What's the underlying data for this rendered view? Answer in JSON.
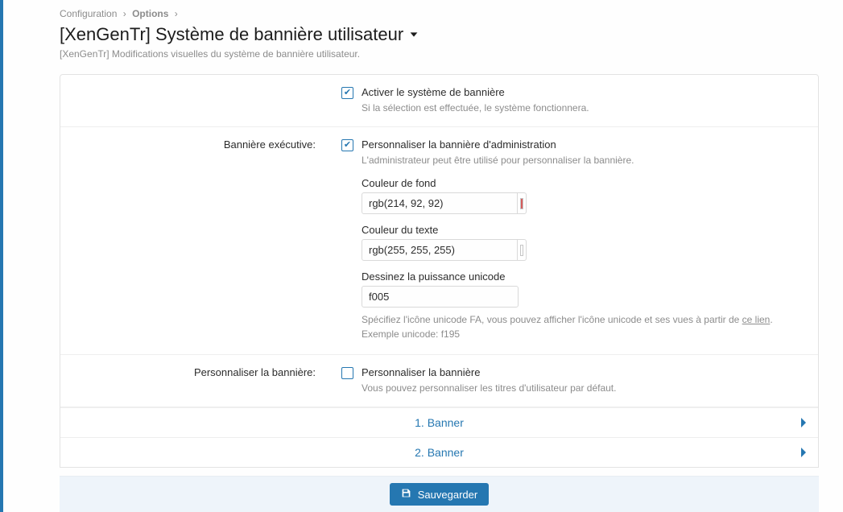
{
  "breadcrumb": {
    "root": "Configuration",
    "current": "Options"
  },
  "page": {
    "title": "[XenGenTr] Système de bannière utilisateur",
    "subtitle": "[XenGenTr] Modifications visuelles du système de bannière utilisateur."
  },
  "sections": {
    "activate": {
      "label": "Activer le système de bannière",
      "desc": "Si la sélection est effectuée, le système fonctionnera.",
      "checked": true
    },
    "executive": {
      "row_label": "Bannière exécutive:",
      "label": "Personnaliser la bannière d'administration",
      "desc": "L'administrateur peut être utilisé pour personnaliser la bannière.",
      "checked": true,
      "bg": {
        "label": "Couleur de fond",
        "value": "rgb(214, 92, 92)",
        "color": "#d65c5c"
      },
      "text": {
        "label": "Couleur du texte",
        "value": "rgb(255, 255, 255)",
        "color": "#ffffff"
      },
      "unicode": {
        "label": "Dessinez la puissance unicode",
        "value": "f005",
        "hint_pre": "Spécifiez l'icône unicode FA, vous pouvez afficher l'icône unicode et ses vues à partir de ",
        "hint_link": "ce lien",
        "hint_post": ".",
        "example": "Exemple unicode: f195"
      }
    },
    "custom": {
      "row_label": "Personnaliser la bannière:",
      "label": "Personnaliser la bannière",
      "desc": "Vous pouvez personnaliser les titres d'utilisateur par défaut.",
      "checked": false
    },
    "banners": {
      "first": "1. Banner",
      "second": "2. Banner"
    }
  },
  "actions": {
    "save": "Sauvegarder"
  }
}
